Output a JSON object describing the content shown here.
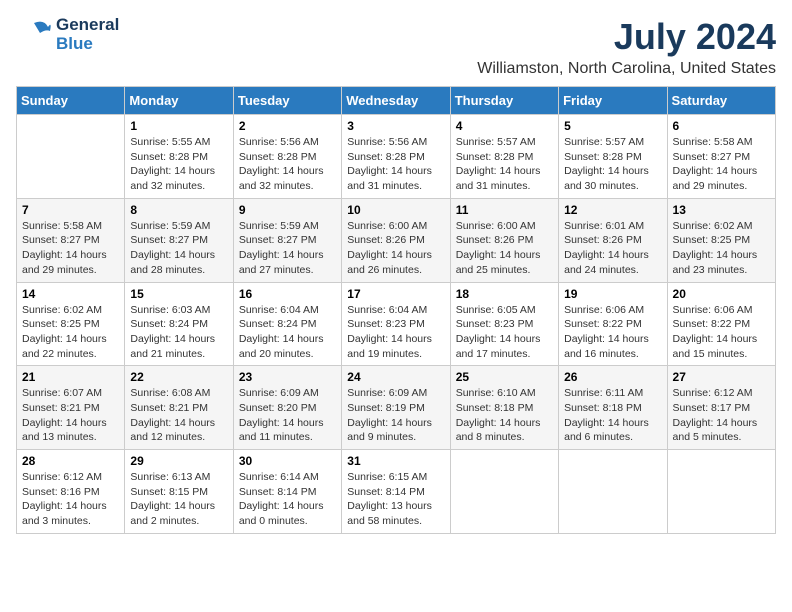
{
  "logo": {
    "line1": "General",
    "line2": "Blue"
  },
  "title": "July 2024",
  "subtitle": "Williamston, North Carolina, United States",
  "weekdays": [
    "Sunday",
    "Monday",
    "Tuesday",
    "Wednesday",
    "Thursday",
    "Friday",
    "Saturday"
  ],
  "weeks": [
    [
      {
        "day": "",
        "sunrise": "",
        "sunset": "",
        "daylight": ""
      },
      {
        "day": "1",
        "sunrise": "5:55 AM",
        "sunset": "8:28 PM",
        "daylight": "14 hours and 32 minutes."
      },
      {
        "day": "2",
        "sunrise": "5:56 AM",
        "sunset": "8:28 PM",
        "daylight": "14 hours and 32 minutes."
      },
      {
        "day": "3",
        "sunrise": "5:56 AM",
        "sunset": "8:28 PM",
        "daylight": "14 hours and 31 minutes."
      },
      {
        "day": "4",
        "sunrise": "5:57 AM",
        "sunset": "8:28 PM",
        "daylight": "14 hours and 31 minutes."
      },
      {
        "day": "5",
        "sunrise": "5:57 AM",
        "sunset": "8:28 PM",
        "daylight": "14 hours and 30 minutes."
      },
      {
        "day": "6",
        "sunrise": "5:58 AM",
        "sunset": "8:27 PM",
        "daylight": "14 hours and 29 minutes."
      }
    ],
    [
      {
        "day": "7",
        "sunrise": "5:58 AM",
        "sunset": "8:27 PM",
        "daylight": "14 hours and 29 minutes."
      },
      {
        "day": "8",
        "sunrise": "5:59 AM",
        "sunset": "8:27 PM",
        "daylight": "14 hours and 28 minutes."
      },
      {
        "day": "9",
        "sunrise": "5:59 AM",
        "sunset": "8:27 PM",
        "daylight": "14 hours and 27 minutes."
      },
      {
        "day": "10",
        "sunrise": "6:00 AM",
        "sunset": "8:26 PM",
        "daylight": "14 hours and 26 minutes."
      },
      {
        "day": "11",
        "sunrise": "6:00 AM",
        "sunset": "8:26 PM",
        "daylight": "14 hours and 25 minutes."
      },
      {
        "day": "12",
        "sunrise": "6:01 AM",
        "sunset": "8:26 PM",
        "daylight": "14 hours and 24 minutes."
      },
      {
        "day": "13",
        "sunrise": "6:02 AM",
        "sunset": "8:25 PM",
        "daylight": "14 hours and 23 minutes."
      }
    ],
    [
      {
        "day": "14",
        "sunrise": "6:02 AM",
        "sunset": "8:25 PM",
        "daylight": "14 hours and 22 minutes."
      },
      {
        "day": "15",
        "sunrise": "6:03 AM",
        "sunset": "8:24 PM",
        "daylight": "14 hours and 21 minutes."
      },
      {
        "day": "16",
        "sunrise": "6:04 AM",
        "sunset": "8:24 PM",
        "daylight": "14 hours and 20 minutes."
      },
      {
        "day": "17",
        "sunrise": "6:04 AM",
        "sunset": "8:23 PM",
        "daylight": "14 hours and 19 minutes."
      },
      {
        "day": "18",
        "sunrise": "6:05 AM",
        "sunset": "8:23 PM",
        "daylight": "14 hours and 17 minutes."
      },
      {
        "day": "19",
        "sunrise": "6:06 AM",
        "sunset": "8:22 PM",
        "daylight": "14 hours and 16 minutes."
      },
      {
        "day": "20",
        "sunrise": "6:06 AM",
        "sunset": "8:22 PM",
        "daylight": "14 hours and 15 minutes."
      }
    ],
    [
      {
        "day": "21",
        "sunrise": "6:07 AM",
        "sunset": "8:21 PM",
        "daylight": "14 hours and 13 minutes."
      },
      {
        "day": "22",
        "sunrise": "6:08 AM",
        "sunset": "8:21 PM",
        "daylight": "14 hours and 12 minutes."
      },
      {
        "day": "23",
        "sunrise": "6:09 AM",
        "sunset": "8:20 PM",
        "daylight": "14 hours and 11 minutes."
      },
      {
        "day": "24",
        "sunrise": "6:09 AM",
        "sunset": "8:19 PM",
        "daylight": "14 hours and 9 minutes."
      },
      {
        "day": "25",
        "sunrise": "6:10 AM",
        "sunset": "8:18 PM",
        "daylight": "14 hours and 8 minutes."
      },
      {
        "day": "26",
        "sunrise": "6:11 AM",
        "sunset": "8:18 PM",
        "daylight": "14 hours and 6 minutes."
      },
      {
        "day": "27",
        "sunrise": "6:12 AM",
        "sunset": "8:17 PM",
        "daylight": "14 hours and 5 minutes."
      }
    ],
    [
      {
        "day": "28",
        "sunrise": "6:12 AM",
        "sunset": "8:16 PM",
        "daylight": "14 hours and 3 minutes."
      },
      {
        "day": "29",
        "sunrise": "6:13 AM",
        "sunset": "8:15 PM",
        "daylight": "14 hours and 2 minutes."
      },
      {
        "day": "30",
        "sunrise": "6:14 AM",
        "sunset": "8:14 PM",
        "daylight": "14 hours and 0 minutes."
      },
      {
        "day": "31",
        "sunrise": "6:15 AM",
        "sunset": "8:14 PM",
        "daylight": "13 hours and 58 minutes."
      },
      {
        "day": "",
        "sunrise": "",
        "sunset": "",
        "daylight": ""
      },
      {
        "day": "",
        "sunrise": "",
        "sunset": "",
        "daylight": ""
      },
      {
        "day": "",
        "sunrise": "",
        "sunset": "",
        "daylight": ""
      }
    ]
  ]
}
